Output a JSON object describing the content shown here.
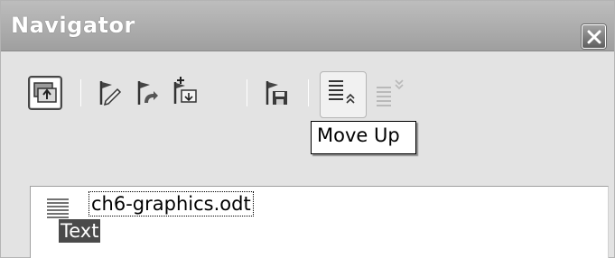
{
  "window": {
    "title": "Navigator",
    "close_icon": "close-icon"
  },
  "toolbar": {
    "items": [
      {
        "name": "toggle-icon",
        "label": "Toggle",
        "state": "pressed"
      },
      {
        "name": "set-reminder-icon",
        "label": "Set Reminder"
      },
      {
        "name": "promote-chapter-icon",
        "label": "Promote Chapter"
      },
      {
        "name": "demote-chapter-icon",
        "label": "Demote Chapter"
      },
      {
        "name": "save-icon",
        "label": "Save"
      },
      {
        "name": "move-up-icon",
        "label": "Move Up",
        "state": "hover"
      },
      {
        "name": "move-down-icon",
        "label": "Move Down",
        "state": "disabled"
      }
    ]
  },
  "tooltip": {
    "text": "Move Up"
  },
  "tree": {
    "document": "ch6-graphics.odt",
    "selected_item": "Text"
  },
  "colors": {
    "titlebar": "#a8a8a8",
    "panel": "#e3e3e3",
    "selection": "#4a4a4a"
  }
}
